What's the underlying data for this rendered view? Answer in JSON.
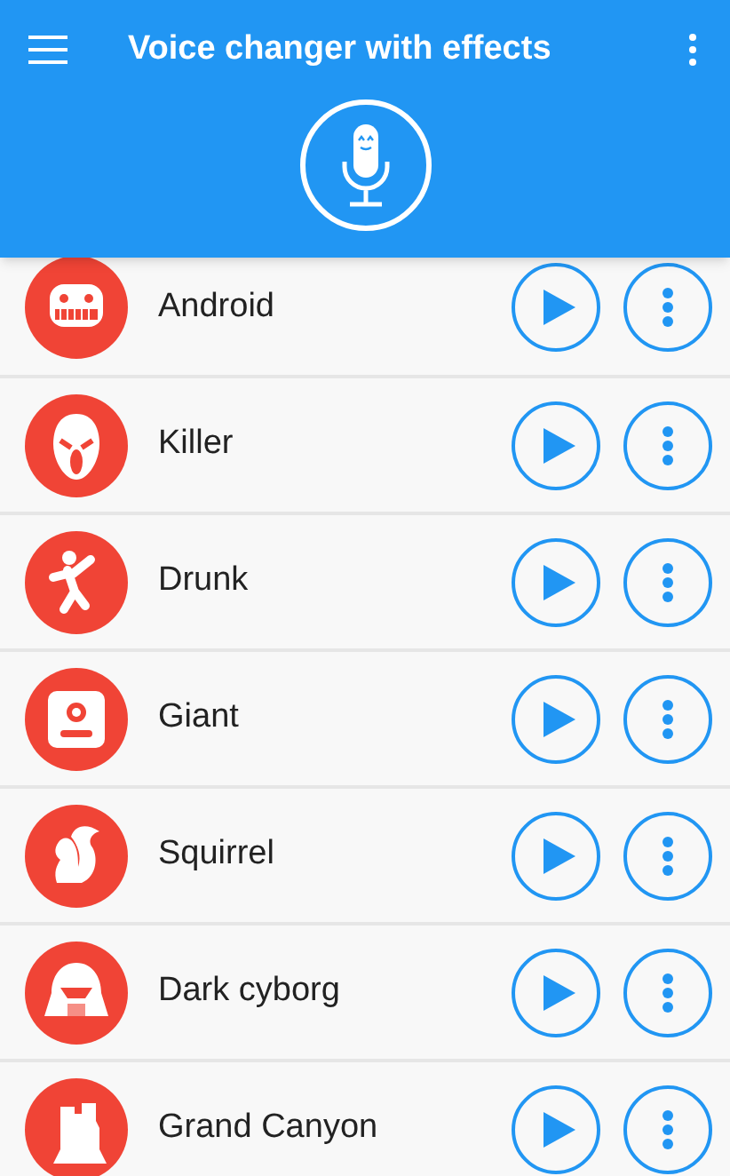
{
  "app_bar": {
    "title": "Voice changer with effects"
  },
  "effects": [
    {
      "kind": "android",
      "name": "Android"
    },
    {
      "kind": "killer",
      "name": "Killer"
    },
    {
      "kind": "drunk",
      "name": "Drunk"
    },
    {
      "kind": "giant",
      "name": "Giant"
    },
    {
      "kind": "squirrel",
      "name": "Squirrel"
    },
    {
      "kind": "cyborg",
      "name": "Dark cyborg"
    },
    {
      "kind": "canyon",
      "name": "Grand Canyon"
    }
  ]
}
